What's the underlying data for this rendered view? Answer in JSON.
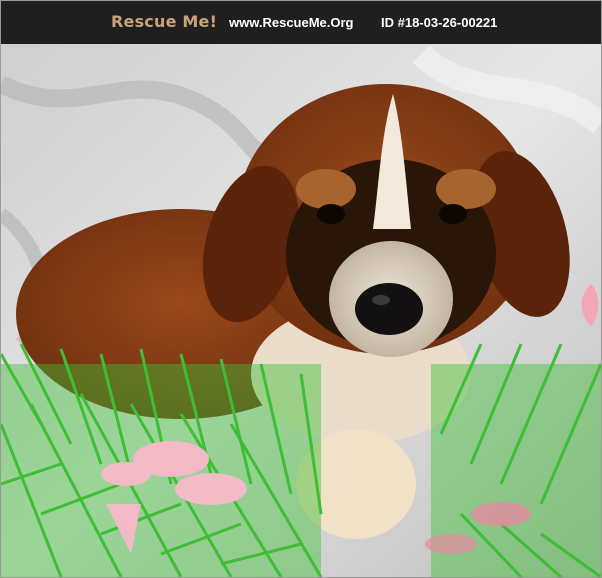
{
  "header": {
    "brand": "Rescue Me!",
    "site": "www.RescueMe.Org",
    "listing_id": "ID #18-03-26-00221"
  },
  "photo": {
    "subject": "puppy",
    "colors": {
      "coat": "#8c3f16",
      "mask": "#2a1608",
      "blaze": "#f2e9dc",
      "background": "#d9d9d9",
      "garland": "#3fbe36",
      "ribbon": "#f2b9c6"
    }
  }
}
